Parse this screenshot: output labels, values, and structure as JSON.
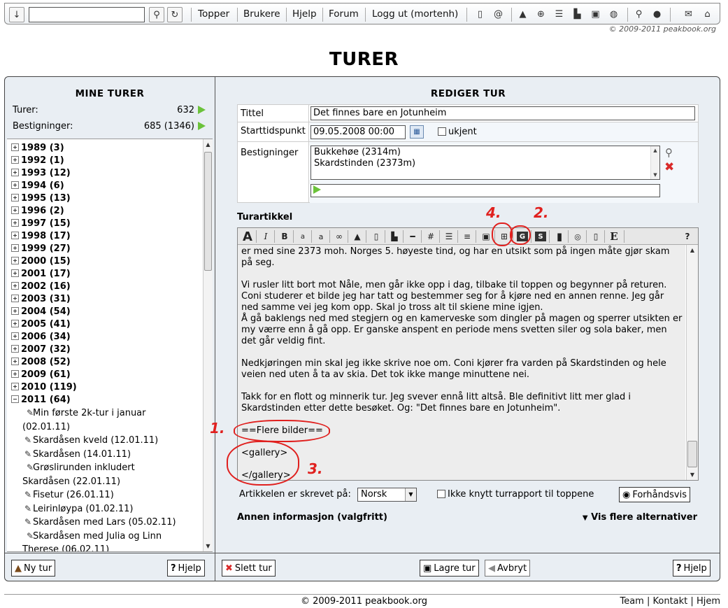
{
  "topbar": {
    "search_value": "",
    "links": [
      "Topper",
      "Brukere",
      "Hjelp",
      "Forum",
      "Logg ut (mortenh)"
    ],
    "copyright": "© 2009-2011 peakbook.org"
  },
  "page_title": "TURER",
  "left": {
    "header": "MINE TURER",
    "turer_label": "Turer:",
    "turer_value": "632",
    "bestigninger_label": "Bestigninger:",
    "bestigninger_value": "685 (1346)",
    "years": [
      {
        "label": "1989 (3)"
      },
      {
        "label": "1992 (1)"
      },
      {
        "label": "1993 (12)"
      },
      {
        "label": "1994 (6)"
      },
      {
        "label": "1995 (13)"
      },
      {
        "label": "1996 (2)"
      },
      {
        "label": "1997 (15)"
      },
      {
        "label": "1998 (17)"
      },
      {
        "label": "1999 (27)"
      },
      {
        "label": "2000 (15)"
      },
      {
        "label": "2001 (17)"
      },
      {
        "label": "2002 (16)"
      },
      {
        "label": "2003 (31)"
      },
      {
        "label": "2004 (54)"
      },
      {
        "label": "2005 (41)"
      },
      {
        "label": "2006 (34)"
      },
      {
        "label": "2007 (32)"
      },
      {
        "label": "2008 (52)"
      },
      {
        "label": "2009 (61)"
      },
      {
        "label": "2010 (119)"
      },
      {
        "label": "2011 (64)"
      }
    ],
    "trips_2011": [
      "Min første 2k-tur i januar (02.01.11)",
      "Skardåsen kveld (12.01.11)",
      "Skardåsen (14.01.11)",
      "Grøslirunden inkludert Skardåsen (22.01.11)",
      "Fisetur (26.01.11)",
      "Leirinløypa (01.02.11)",
      "Skardåsen med Lars (05.02.11)",
      "Skardåsen med Julia og Linn Therese (06.02.11)"
    ],
    "new_trip_button": "Ny tur",
    "help_button": "Hjelp"
  },
  "right": {
    "header": "REDIGER TUR",
    "tittel_label": "Tittel",
    "tittel_value": "Det finnes bare en Jotunheim",
    "start_label": "Starttidspunkt",
    "start_value": "09.05.2008 00:00",
    "unknown_label": "ukjent",
    "best_label": "Bestigninger",
    "peaks": [
      "Bukkehøe (2314m)",
      "Skardstinden (2373m)"
    ],
    "peak_input": "",
    "artikkel_label": "Turartikkel",
    "article_paragraphs": [
      "er med sine 2373 moh. Norges 5. høyeste tind, og har en utsikt som på ingen måte gjør skam på seg.",
      "Vi rusler litt bort mot Nåle, men går ikke opp i dag, tilbake til toppen og begynner på returen. Coni studerer et bilde jeg har tatt og bestemmer seg for å kjøre ned en annen renne. Jeg går ned samme vei jeg kom opp. Skal jo tross alt til skiene mine igjen.",
      "Å gå baklengs ned med stegjern og en kamerveske som dingler på magen og sperrer utsikten er my værre enn å gå opp. Er ganske anspent en periode mens svetten siler og sola baker, men det går veldig fint.",
      "Nedkjøringen min skal jeg ikke skrive noe om. Coni kjører fra varden på Skardstinden og hele veien ned uten å ta av skia. Det tok ikke mange minuttene nei.",
      "Takk for en flott og minnerik tur. Jeg svever ennå litt altså. Ble definitivt litt mer glad i Skardstinden etter dette besøket. Og: \"Det finnes bare en Jotunheim\".",
      "==Flere bilder==",
      "<gallery>",
      "</gallery>"
    ],
    "lang_label": "Artikkelen er skrevet på:",
    "lang_value": "Norsk",
    "no_link_label": "Ikke knytt turrapport til toppene",
    "preview_button": "Forhåndsvis",
    "annen_label": "Annen informasjon (valgfritt)",
    "vis_flere": "Vis flere alternativer",
    "delete_button": "Slett tur",
    "save_button": "Lagre tur",
    "cancel_button": "Avbryt",
    "help_button": "Hjelp"
  },
  "annotations": [
    "1.",
    "2.",
    "3.",
    "4."
  ],
  "footer": {
    "copyright": "© 2009-2011 peakbook.org",
    "links": [
      "Team",
      "Kontakt",
      "Hjem"
    ]
  },
  "colors": {
    "accent_green": "#6bc23a",
    "annotation_red": "#e0201e",
    "delete_red": "#d92a2a"
  }
}
